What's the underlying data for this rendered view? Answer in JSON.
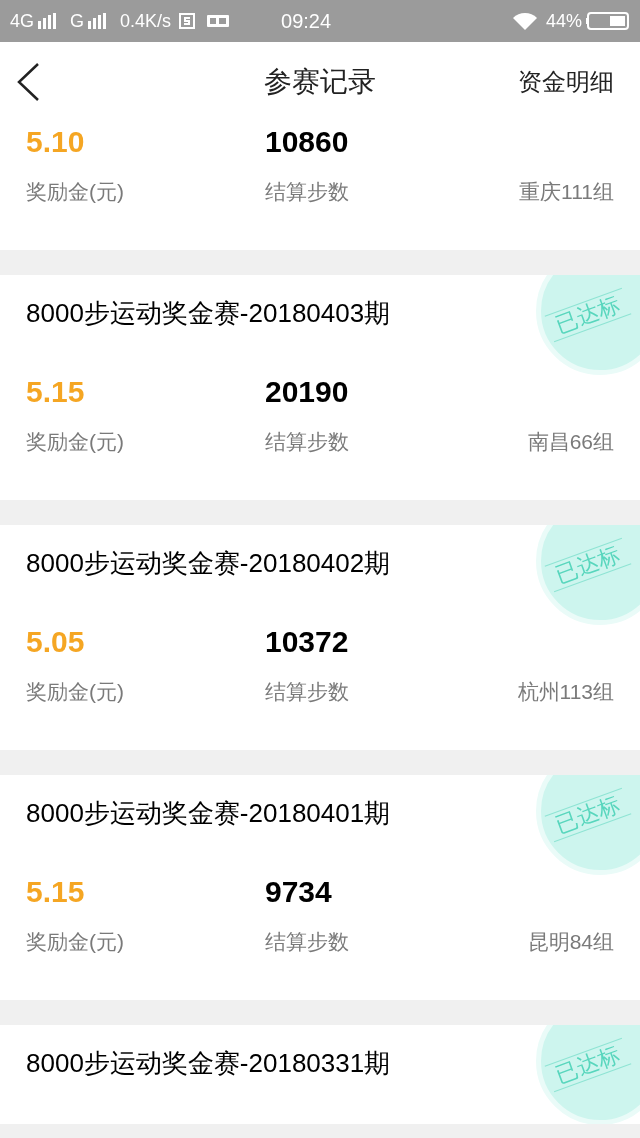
{
  "status_bar": {
    "sim1": "4G",
    "sim2": "G",
    "speed": "0.4K/s",
    "time": "09:24",
    "battery": "44%"
  },
  "header": {
    "title": "参赛记录",
    "action": "资金明细"
  },
  "records": [
    {
      "reward": "5.10",
      "reward_label": "奖励金(元)",
      "steps": "10860",
      "steps_label": "结算步数",
      "group": "重庆111组",
      "reached": false
    },
    {
      "title": "8000步运动奖金赛-20180403期",
      "reward": "5.15",
      "reward_label": "奖励金(元)",
      "steps": "20190",
      "steps_label": "结算步数",
      "group": "南昌66组",
      "reached": true,
      "stamp": "已达标"
    },
    {
      "title": "8000步运动奖金赛-20180402期",
      "reward": "5.05",
      "reward_label": "奖励金(元)",
      "steps": "10372",
      "steps_label": "结算步数",
      "group": "杭州113组",
      "reached": true,
      "stamp": "已达标"
    },
    {
      "title": "8000步运动奖金赛-20180401期",
      "reward": "5.15",
      "reward_label": "奖励金(元)",
      "steps": "9734",
      "steps_label": "结算步数",
      "group": "昆明84组",
      "reached": true,
      "stamp": "已达标"
    },
    {
      "title": "8000步运动奖金赛-20180331期",
      "reached": true,
      "stamp": "已达标"
    }
  ]
}
